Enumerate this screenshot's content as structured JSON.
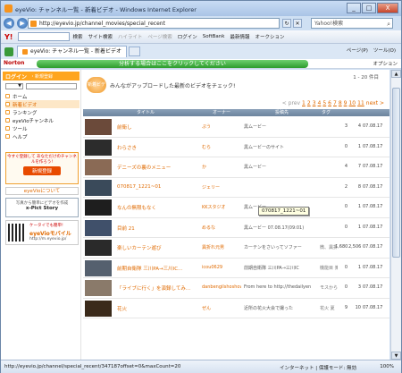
{
  "window": {
    "title": "eyeVio: チャンネル一覧 - 新着ビデオ - Windows Internet Explorer",
    "min": "_",
    "max": "□",
    "close": "X"
  },
  "address": {
    "url": "http://eyevio.jp/channel_movies/special_recent",
    "search_placeholder": "Yahoo!検索",
    "back_icon": "back-arrow-icon",
    "forward_icon": "forward-arrow-icon"
  },
  "toolbar": {
    "logo": "Y!",
    "items": [
      "検索",
      "サイト検索",
      "ハイライト",
      "ページ検索",
      "ログイン",
      "SoftBank",
      "最新情報",
      "オークション"
    ],
    "dim": [
      false,
      false,
      true,
      true,
      false,
      false,
      false,
      false
    ]
  },
  "tabs": {
    "active": "eyeVio: チャンネル一覧 - 新着ビデオ",
    "right_items": [
      "ページ(P)",
      "ツール(O)"
    ]
  },
  "norton": {
    "logo": "Norton",
    "message": "分析する場合はここをクリックしてください",
    "options": "オプション"
  },
  "sidebar": {
    "login": "ログイン",
    "register": "・新規登録",
    "select_value": "▼",
    "nav": [
      {
        "label": "ホーム",
        "active": false
      },
      {
        "label": "新着ビデオ",
        "active": true
      },
      {
        "label": "ランキング",
        "active": false
      },
      {
        "label": "eyeVioチャンネル",
        "active": false
      },
      {
        "label": "ツール",
        "active": false
      },
      {
        "label": "ヘルプ",
        "active": false
      }
    ],
    "promo_text": "今すぐ登録して あなただけのチャンネルを作ろう!",
    "promo_button": "新規登録",
    "about": "eyeVioについて",
    "banner_line1": "写真から簡単にビデオを作成",
    "banner_line2": "x-Pict Story",
    "mobile_line1": "ケータイでも簡単!",
    "mobile_line2": "eyeVioモバイル",
    "mobile_line3": "http://m.eyevio.jp/"
  },
  "main": {
    "icon_label": "新着ビデオ",
    "description": "みんながアップロードした最新のビデオをチェック!",
    "range": "1 - 20 件目",
    "pager": {
      "prev": "< prev",
      "pages": [
        "1",
        "2",
        "3",
        "4",
        "5",
        "6",
        "7",
        "8",
        "9",
        "10",
        "11"
      ],
      "next": "next >"
    },
    "columns": [
      "タイトル",
      "オーナー",
      "投稿先",
      "タグ",
      "",
      "",
      ""
    ],
    "rows": [
      {
        "title": "前衛し",
        "user": "ぷう",
        "channel": "黒ムービー",
        "tag": "",
        "n1": "3",
        "n2": "4",
        "date": "07.08.17"
      },
      {
        "title": "わらさき",
        "user": "むら",
        "channel": "黒ムービーのサイト",
        "tag": "",
        "n1": "0",
        "n2": "1",
        "date": "07.08.17"
      },
      {
        "title": "デニーズの裏のメニュー",
        "user": "か",
        "channel": "黒ムービー",
        "tag": "",
        "n1": "4",
        "n2": "7",
        "date": "07.08.17"
      },
      {
        "title": "070817_1221~01",
        "user": "ジェリー",
        "channel": "",
        "tag": "",
        "n1": "2",
        "n2": "8",
        "date": "07.08.17"
      },
      {
        "title": "なんの無限もなく",
        "user": "KKスタジオ",
        "channel": "黒ムービー",
        "tag": "",
        "n1": "0",
        "n2": "1",
        "date": "07.08.17"
      },
      {
        "title": "目前 21",
        "user": "めるな",
        "channel": "黒ムービー 07.08.17(09:01)",
        "tag": "",
        "n1": "0",
        "n2": "1",
        "date": "07.08.17"
      },
      {
        "title": "楽しいカーテン遊び",
        "user": "異折れ元男",
        "channel": "カーテンをさいってソファー",
        "tag": "微、異折れ元",
        "n1": "1,680",
        "n2": "2,506",
        "date": "07.08.17"
      },
      {
        "title": "前期自衛隊 三川PA→三川IC...",
        "user": "icou0629",
        "channel": "前期自衛隊 三川PA→三川IC",
        "tag": "機能目 楽園",
        "n1": "0",
        "n2": "1",
        "date": "07.08.17"
      },
      {
        "title": "「ライブに行く」を演録してみ...",
        "user": "danbengilshoshow",
        "channel": "From here to http://thedailyen",
        "tag": "モスから学習",
        "n1": "0",
        "n2": "3",
        "date": "07.08.17"
      },
      {
        "title": "花火",
        "user": "ぜん",
        "channel": "近所の花火大会で撮った",
        "tag": "花火 夏",
        "n1": "9",
        "n2": "10",
        "date": "07.08.17"
      }
    ],
    "tooltip": "070817_1221~01"
  },
  "status": {
    "url": "http://eyevio.jp/channel/special_recent/347187offset=0&maxCount=20",
    "zone": "インターネット | 保護モード: 無効",
    "zoom": "100%"
  }
}
